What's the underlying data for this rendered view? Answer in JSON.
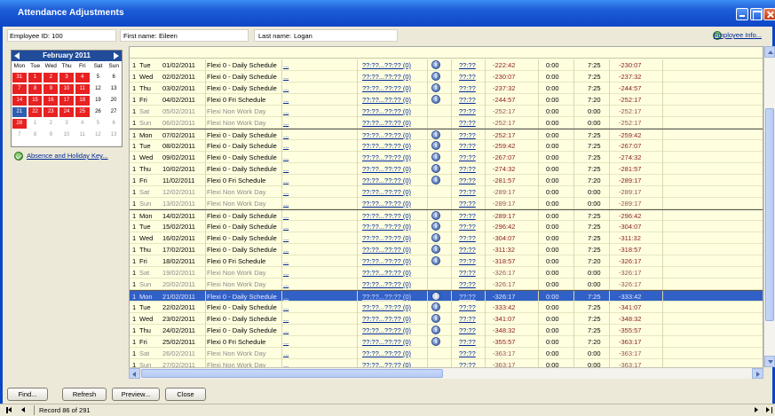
{
  "window": {
    "title": "Attendance Adjustments"
  },
  "header": {
    "employee_id_label": "Employee ID: 100",
    "first_name_label": "First name:",
    "first_name_value": "Eileen",
    "last_name_label": "Last name:",
    "last_name_value": "Logan",
    "employee_info_link": "Employee Info..."
  },
  "calendar": {
    "month": "February 2011",
    "weekdays": [
      "Mon",
      "Tue",
      "Wed",
      "Thu",
      "Fri",
      "Sat",
      "Sun"
    ],
    "days": [
      {
        "d": "31",
        "s": "red"
      },
      {
        "d": "1",
        "s": "red"
      },
      {
        "d": "2",
        "s": "red"
      },
      {
        "d": "3",
        "s": "red"
      },
      {
        "d": "4",
        "s": "red"
      },
      {
        "d": "5",
        "s": ""
      },
      {
        "d": "6",
        "s": ""
      },
      {
        "d": "7",
        "s": "red"
      },
      {
        "d": "8",
        "s": "red"
      },
      {
        "d": "9",
        "s": "red"
      },
      {
        "d": "10",
        "s": "red"
      },
      {
        "d": "11",
        "s": "red"
      },
      {
        "d": "12",
        "s": ""
      },
      {
        "d": "13",
        "s": ""
      },
      {
        "d": "14",
        "s": "red"
      },
      {
        "d": "15",
        "s": "red"
      },
      {
        "d": "16",
        "s": "red"
      },
      {
        "d": "17",
        "s": "red"
      },
      {
        "d": "18",
        "s": "red"
      },
      {
        "d": "19",
        "s": ""
      },
      {
        "d": "20",
        "s": ""
      },
      {
        "d": "21",
        "s": "blue"
      },
      {
        "d": "22",
        "s": "red"
      },
      {
        "d": "23",
        "s": "red"
      },
      {
        "d": "24",
        "s": "red"
      },
      {
        "d": "25",
        "s": "red"
      },
      {
        "d": "26",
        "s": ""
      },
      {
        "d": "27",
        "s": ""
      },
      {
        "d": "28",
        "s": "red"
      },
      {
        "d": "1",
        "s": "grey"
      },
      {
        "d": "2",
        "s": "grey"
      },
      {
        "d": "3",
        "s": "grey"
      },
      {
        "d": "4",
        "s": "grey"
      },
      {
        "d": "5",
        "s": "grey"
      },
      {
        "d": "6",
        "s": "grey"
      },
      {
        "d": "7",
        "s": "grey"
      },
      {
        "d": "8",
        "s": "grey"
      },
      {
        "d": "9",
        "s": "grey"
      },
      {
        "d": "10",
        "s": "grey"
      },
      {
        "d": "11",
        "s": "grey"
      },
      {
        "d": "12",
        "s": "grey"
      },
      {
        "d": "13",
        "s": "grey"
      }
    ]
  },
  "absence_link": "Absence and Holiday Key...",
  "grid": {
    "rows": [
      {
        "week": "1",
        "day": "Tue",
        "date": "01/02/2011",
        "sched": "Flexi 0 - Daily Schedule",
        "more": "...",
        "clock": "??:??...??:?? (0)",
        "info": true,
        "time": "??:??",
        "bal1": "-222:42",
        "h": "0:00",
        "req": "7:25",
        "bal2": "-230:07",
        "weekend": false,
        "weekstart": false,
        "selected": false
      },
      {
        "week": "1",
        "day": "Wed",
        "date": "02/02/2011",
        "sched": "Flexi 0 - Daily Schedule",
        "more": "...",
        "clock": "??:??...??:?? (0)",
        "info": true,
        "time": "??:??",
        "bal1": "-230:07",
        "h": "0:00",
        "req": "7:25",
        "bal2": "-237:32",
        "weekend": false,
        "weekstart": false,
        "selected": false
      },
      {
        "week": "1",
        "day": "Thu",
        "date": "03/02/2011",
        "sched": "Flexi 0 - Daily Schedule",
        "more": "...",
        "clock": "??:??...??:?? (0)",
        "info": true,
        "time": "??:??",
        "bal1": "-237:32",
        "h": "0:00",
        "req": "7:25",
        "bal2": "-244:57",
        "weekend": false,
        "weekstart": false,
        "selected": false
      },
      {
        "week": "1",
        "day": "Fri",
        "date": "04/02/2011",
        "sched": "Flexi 0 Fri Schedule",
        "more": "...",
        "clock": "??:??...??:?? (0)",
        "info": true,
        "time": "??:??",
        "bal1": "-244:57",
        "h": "0:00",
        "req": "7:20",
        "bal2": "-252:17",
        "weekend": false,
        "weekstart": false,
        "selected": false
      },
      {
        "week": "1",
        "day": "Sat",
        "date": "05/02/2011",
        "sched": "Flexi Non Work Day",
        "more": "...",
        "clock": "??:??...??:?? (0)",
        "info": false,
        "time": "??:??",
        "bal1": "-252:17",
        "h": "0:00",
        "req": "0:00",
        "bal2": "-252:17",
        "weekend": true,
        "weekstart": false,
        "selected": false
      },
      {
        "week": "1",
        "day": "Sun",
        "date": "06/02/2011",
        "sched": "Flexi Non Work Day",
        "more": "...",
        "clock": "??:??...??:?? (0)",
        "info": false,
        "time": "??:??",
        "bal1": "-252:17",
        "h": "0:00",
        "req": "0:00",
        "bal2": "-252:17",
        "weekend": true,
        "weekstart": false,
        "selected": false
      },
      {
        "week": "1",
        "day": "Mon",
        "date": "07/02/2011",
        "sched": "Flexi 0 - Daily Schedule",
        "more": "...",
        "clock": "??:??...??:?? (0)",
        "info": true,
        "time": "??:??",
        "bal1": "-252:17",
        "h": "0:00",
        "req": "7:25",
        "bal2": "-259:42",
        "weekend": false,
        "weekstart": true,
        "selected": false
      },
      {
        "week": "1",
        "day": "Tue",
        "date": "08/02/2011",
        "sched": "Flexi 0 - Daily Schedule",
        "more": "...",
        "clock": "??:??...??:?? (0)",
        "info": true,
        "time": "??:??",
        "bal1": "-259:42",
        "h": "0:00",
        "req": "7:25",
        "bal2": "-267:07",
        "weekend": false,
        "weekstart": false,
        "selected": false
      },
      {
        "week": "1",
        "day": "Wed",
        "date": "09/02/2011",
        "sched": "Flexi 0 - Daily Schedule",
        "more": "...",
        "clock": "??:??...??:?? (0)",
        "info": true,
        "time": "??:??",
        "bal1": "-267:07",
        "h": "0:00",
        "req": "7:25",
        "bal2": "-274:32",
        "weekend": false,
        "weekstart": false,
        "selected": false
      },
      {
        "week": "1",
        "day": "Thu",
        "date": "10/02/2011",
        "sched": "Flexi 0 - Daily Schedule",
        "more": "...",
        "clock": "??:??...??:?? (0)",
        "info": true,
        "time": "??:??",
        "bal1": "-274:32",
        "h": "0:00",
        "req": "7:25",
        "bal2": "-281:57",
        "weekend": false,
        "weekstart": false,
        "selected": false
      },
      {
        "week": "1",
        "day": "Fri",
        "date": "11/02/2011",
        "sched": "Flexi 0 Fri Schedule",
        "more": "...",
        "clock": "??:??...??:?? (0)",
        "info": true,
        "time": "??:??",
        "bal1": "-281:57",
        "h": "0:00",
        "req": "7:20",
        "bal2": "-289:17",
        "weekend": false,
        "weekstart": false,
        "selected": false
      },
      {
        "week": "1",
        "day": "Sat",
        "date": "12/02/2011",
        "sched": "Flexi Non Work Day",
        "more": "...",
        "clock": "??:??...??:?? (0)",
        "info": false,
        "time": "??:??",
        "bal1": "-289:17",
        "h": "0:00",
        "req": "0:00",
        "bal2": "-289:17",
        "weekend": true,
        "weekstart": false,
        "selected": false
      },
      {
        "week": "1",
        "day": "Sun",
        "date": "13/02/2011",
        "sched": "Flexi Non Work Day",
        "more": "...",
        "clock": "??:??...??:?? (0)",
        "info": false,
        "time": "??:??",
        "bal1": "-289:17",
        "h": "0:00",
        "req": "0:00",
        "bal2": "-289:17",
        "weekend": true,
        "weekstart": false,
        "selected": false
      },
      {
        "week": "1",
        "day": "Mon",
        "date": "14/02/2011",
        "sched": "Flexi 0 - Daily Schedule",
        "more": "...",
        "clock": "??:??...??:?? (0)",
        "info": true,
        "time": "??:??",
        "bal1": "-289:17",
        "h": "0:00",
        "req": "7:25",
        "bal2": "-296:42",
        "weekend": false,
        "weekstart": true,
        "selected": false
      },
      {
        "week": "1",
        "day": "Tue",
        "date": "15/02/2011",
        "sched": "Flexi 0 - Daily Schedule",
        "more": "...",
        "clock": "??:??...??:?? (0)",
        "info": true,
        "time": "??:??",
        "bal1": "-296:42",
        "h": "0:00",
        "req": "7:25",
        "bal2": "-304:07",
        "weekend": false,
        "weekstart": false,
        "selected": false
      },
      {
        "week": "1",
        "day": "Wed",
        "date": "16/02/2011",
        "sched": "Flexi 0 - Daily Schedule",
        "more": "...",
        "clock": "??:??...??:?? (0)",
        "info": true,
        "time": "??:??",
        "bal1": "-304:07",
        "h": "0:00",
        "req": "7:25",
        "bal2": "-311:32",
        "weekend": false,
        "weekstart": false,
        "selected": false
      },
      {
        "week": "1",
        "day": "Thu",
        "date": "17/02/2011",
        "sched": "Flexi 0 - Daily Schedule",
        "more": "...",
        "clock": "??:??...??:?? (0)",
        "info": true,
        "time": "??:??",
        "bal1": "-311:32",
        "h": "0:00",
        "req": "7:25",
        "bal2": "-318:57",
        "weekend": false,
        "weekstart": false,
        "selected": false
      },
      {
        "week": "1",
        "day": "Fri",
        "date": "18/02/2011",
        "sched": "Flexi 0 Fri Schedule",
        "more": "...",
        "clock": "??:??...??:?? (0)",
        "info": true,
        "time": "??:??",
        "bal1": "-318:57",
        "h": "0:00",
        "req": "7:20",
        "bal2": "-326:17",
        "weekend": false,
        "weekstart": false,
        "selected": false
      },
      {
        "week": "1",
        "day": "Sat",
        "date": "19/02/2011",
        "sched": "Flexi Non Work Day",
        "more": "...",
        "clock": "??:??...??:?? (0)",
        "info": false,
        "time": "??:??",
        "bal1": "-326:17",
        "h": "0:00",
        "req": "0:00",
        "bal2": "-326:17",
        "weekend": true,
        "weekstart": false,
        "selected": false
      },
      {
        "week": "1",
        "day": "Sun",
        "date": "20/02/2011",
        "sched": "Flexi Non Work Day",
        "more": "...",
        "clock": "??:??...??:?? (0)",
        "info": false,
        "time": "??:??",
        "bal1": "-326:17",
        "h": "0:00",
        "req": "0:00",
        "bal2": "-326:17",
        "weekend": true,
        "weekstart": false,
        "selected": false
      },
      {
        "week": "1",
        "day": "Mon",
        "date": "21/02/2011",
        "sched": "Flexi 0 - Daily Schedule",
        "more": "...",
        "clock": "??:??...??:?? (0)",
        "info": true,
        "time": "??:??",
        "bal1": "-326:17",
        "h": "0:00",
        "req": "7:25",
        "bal2": "-333:42",
        "weekend": false,
        "weekstart": true,
        "selected": true
      },
      {
        "week": "1",
        "day": "Tue",
        "date": "22/02/2011",
        "sched": "Flexi 0 - Daily Schedule",
        "more": "...",
        "clock": "??:??...??:?? (0)",
        "info": true,
        "time": "??:??",
        "bal1": "-333:42",
        "h": "0:00",
        "req": "7:25",
        "bal2": "-341:07",
        "weekend": false,
        "weekstart": false,
        "selected": false
      },
      {
        "week": "1",
        "day": "Wed",
        "date": "23/02/2011",
        "sched": "Flexi 0 - Daily Schedule",
        "more": "...",
        "clock": "??:??...??:?? (0)",
        "info": true,
        "time": "??:??",
        "bal1": "-341:07",
        "h": "0:00",
        "req": "7:25",
        "bal2": "-348:32",
        "weekend": false,
        "weekstart": false,
        "selected": false
      },
      {
        "week": "1",
        "day": "Thu",
        "date": "24/02/2011",
        "sched": "Flexi 0 - Daily Schedule",
        "more": "...",
        "clock": "??:??...??:?? (0)",
        "info": true,
        "time": "??:??",
        "bal1": "-348:32",
        "h": "0:00",
        "req": "7:25",
        "bal2": "-355:57",
        "weekend": false,
        "weekstart": false,
        "selected": false
      },
      {
        "week": "1",
        "day": "Fri",
        "date": "25/02/2011",
        "sched": "Flexi 0 Fri Schedule",
        "more": "...",
        "clock": "??:??...??:?? (0)",
        "info": true,
        "time": "??:??",
        "bal1": "-355:57",
        "h": "0:00",
        "req": "7:20",
        "bal2": "-363:17",
        "weekend": false,
        "weekstart": false,
        "selected": false
      },
      {
        "week": "1",
        "day": "Sat",
        "date": "26/02/2011",
        "sched": "Flexi Non Work Day",
        "more": "...",
        "clock": "??:??...??:?? (0)",
        "info": false,
        "time": "??:??",
        "bal1": "-363:17",
        "h": "0:00",
        "req": "0:00",
        "bal2": "-363:17",
        "weekend": true,
        "weekstart": false,
        "selected": false
      },
      {
        "week": "1",
        "day": "Sun",
        "date": "27/02/2011",
        "sched": "Flexi Non Work Day",
        "more": "...",
        "clock": "??:??...??:?? (0)",
        "info": false,
        "time": "??:??",
        "bal1": "-363:17",
        "h": "0:00",
        "req": "0:00",
        "bal2": "-363:17",
        "weekend": true,
        "weekstart": false,
        "selected": false
      }
    ]
  },
  "buttons": {
    "find": "Find...",
    "refresh": "Refresh",
    "preview": "Preview...",
    "close": "Close"
  },
  "navigator": {
    "record_text": "Record 86 of 291"
  }
}
